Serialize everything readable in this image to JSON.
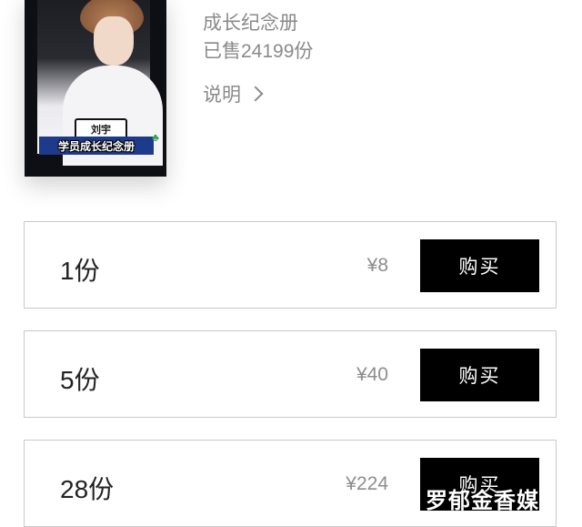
{
  "product": {
    "cover": {
      "name_tag": "刘宇",
      "banner": "学员成长纪念册"
    },
    "title": "成长纪念册",
    "sold": "已售24199份",
    "explain_label": "说明"
  },
  "packages": [
    {
      "quantity": "1份",
      "price": "¥8",
      "buy_label": "购买"
    },
    {
      "quantity": "5份",
      "price": "¥40",
      "buy_label": "购买"
    },
    {
      "quantity": "28份",
      "price": "¥224",
      "buy_label": "购买"
    }
  ],
  "watermark": "罗郁金香媒",
  "icons": {
    "explain": "chevron-right-icon"
  }
}
